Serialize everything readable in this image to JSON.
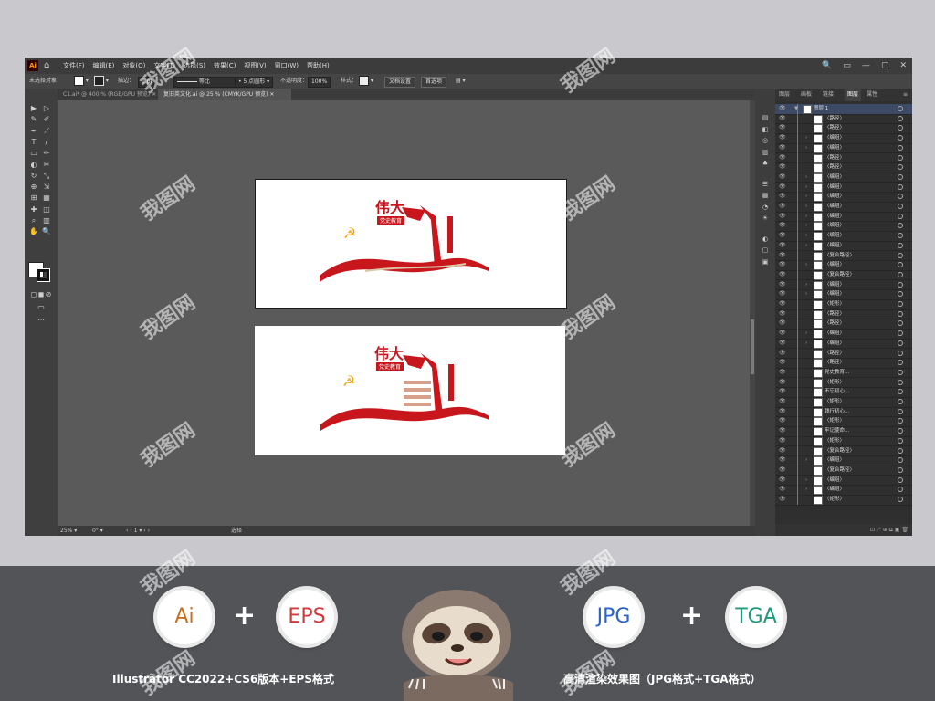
{
  "app": {
    "logo": "Ai",
    "menu": [
      "文件(F)",
      "编辑(E)",
      "对象(O)",
      "文字(T)",
      "选择(S)",
      "效果(C)",
      "视图(V)",
      "窗口(W)",
      "帮助(H)"
    ],
    "win_controls": [
      "🔍",
      "▭",
      "—",
      "▢",
      "✕"
    ]
  },
  "control_bar": {
    "selection": "未选择对象",
    "stroke_label": "描边：",
    "stroke_value": "1 pt",
    "stroke_style": "等比",
    "brush": "5 点圆形",
    "opacity_label": "不透明度：",
    "opacity_value": "100%",
    "style_label": "样式：",
    "doc_setup": "文档设置",
    "prefs": "首选项"
  },
  "tabs": [
    {
      "label": "C1.ai* @ 400 % (RGB/GPU 预览)",
      "active": false
    },
    {
      "label": "复旧英文化.ai @ 25 % (CMYK/GPU 预览)",
      "active": true
    }
  ],
  "statusbar": {
    "zoom": "25%",
    "rotation": "0°",
    "page": "1",
    "tool": "选择"
  },
  "artwork": {
    "title_top": "伟大",
    "banner": "党史教育"
  },
  "layers_panel": {
    "tabs": [
      "图层",
      "画板",
      "链接",
      "图层",
      "属性"
    ],
    "rows": [
      {
        "name": "图层 1",
        "indent": 0,
        "arrow": "▼",
        "top": true
      },
      {
        "name": "〈路径〉",
        "indent": 1
      },
      {
        "name": "〈路径〉",
        "indent": 1
      },
      {
        "name": "〈编组〉",
        "indent": 1,
        "arrow": "›"
      },
      {
        "name": "〈编组〉",
        "indent": 1,
        "arrow": "›"
      },
      {
        "name": "〈路径〉",
        "indent": 1
      },
      {
        "name": "〈路径〉",
        "indent": 1
      },
      {
        "name": "〈编组〉",
        "indent": 1,
        "arrow": "›"
      },
      {
        "name": "〈编组〉",
        "indent": 1,
        "arrow": "›"
      },
      {
        "name": "〈编组〉",
        "indent": 1,
        "arrow": "›"
      },
      {
        "name": "〈编组〉",
        "indent": 1,
        "arrow": "›"
      },
      {
        "name": "〈编组〉",
        "indent": 1,
        "arrow": "›"
      },
      {
        "name": "〈编组〉",
        "indent": 1,
        "arrow": "›"
      },
      {
        "name": "〈编组〉",
        "indent": 1,
        "arrow": "›"
      },
      {
        "name": "〈编组〉",
        "indent": 1,
        "arrow": "›"
      },
      {
        "name": "〈复合路径〉",
        "indent": 1
      },
      {
        "name": "〈编组〉",
        "indent": 1,
        "arrow": "›"
      },
      {
        "name": "〈复合路径〉",
        "indent": 1
      },
      {
        "name": "〈编组〉",
        "indent": 1,
        "arrow": "›"
      },
      {
        "name": "〈编组〉",
        "indent": 1,
        "arrow": "›"
      },
      {
        "name": "〈矩形〉",
        "indent": 1
      },
      {
        "name": "〈路径〉",
        "indent": 1
      },
      {
        "name": "〈路径〉",
        "indent": 1
      },
      {
        "name": "〈编组〉",
        "indent": 1,
        "arrow": "›"
      },
      {
        "name": "〈编组〉",
        "indent": 1,
        "arrow": "›"
      },
      {
        "name": "〈路径〉",
        "indent": 1
      },
      {
        "name": "〈路径〉",
        "indent": 1
      },
      {
        "name": "党史教育...",
        "indent": 1
      },
      {
        "name": "〈矩形〉",
        "indent": 1
      },
      {
        "name": "不忘初心...",
        "indent": 1
      },
      {
        "name": "〈矩形〉",
        "indent": 1
      },
      {
        "name": "践行初心...",
        "indent": 1
      },
      {
        "name": "〈矩形〉",
        "indent": 1
      },
      {
        "name": "牢记使命...",
        "indent": 1
      },
      {
        "name": "〈矩形〉",
        "indent": 1
      },
      {
        "name": "〈复合路径〉",
        "indent": 1
      },
      {
        "name": "〈编组〉",
        "indent": 1,
        "arrow": "›"
      },
      {
        "name": "〈复合路径〉",
        "indent": 1
      },
      {
        "name": "〈编组〉",
        "indent": 1,
        "arrow": "›"
      },
      {
        "name": "〈编组〉",
        "indent": 1,
        "arrow": "›"
      },
      {
        "name": "〈矩形〉",
        "indent": 1
      }
    ]
  },
  "promo": {
    "badges": [
      {
        "label": "Ai",
        "color": "#c8701e"
      },
      {
        "label": "EPS",
        "color": "#d23a3a"
      },
      {
        "label": "JPG",
        "color": "#2a63c9"
      },
      {
        "label": "TGA",
        "color": "#1f9a7a"
      }
    ],
    "plus": "+",
    "caption_left": "Illustrator CC2022+CS6版本+EPS格式",
    "caption_right": "高清渲染效果图（JPG格式+TGA格式）"
  },
  "watermark": "我图网",
  "colors": {
    "party_red": "#c8161d",
    "gold": "#f2a81d",
    "layer_bar": "#4a7bd8"
  }
}
